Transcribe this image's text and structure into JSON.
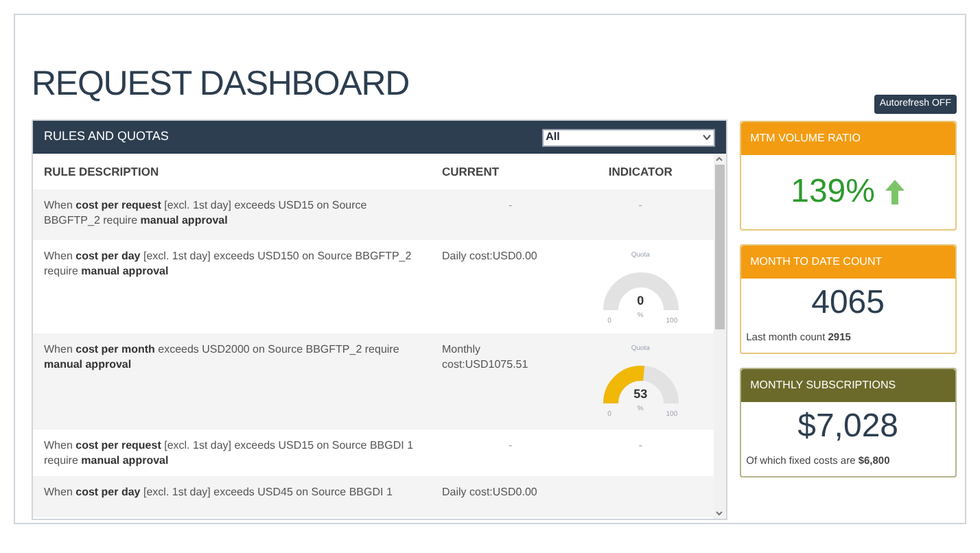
{
  "page_title": "REQUEST DASHBOARD",
  "autorefresh_button": "Autorefresh OFF",
  "rules_panel": {
    "title": "RULES AND QUOTAS",
    "filter": {
      "value": "All"
    },
    "columns": [
      "RULE DESCRIPTION",
      "CURRENT",
      "INDICATOR"
    ],
    "rows": [
      {
        "description": "When **cost per request** [excl. 1st day] exceeds USD15 on Source BBGFTP_2 require **manual approval**",
        "current": "-",
        "indicator": {
          "kind": "none",
          "text": "-"
        }
      },
      {
        "description": "When **cost per day** [excl. 1st day] exceeds USD150 on Source BBGFTP_2 require **manual approval**",
        "current": "Daily cost:USD0.00",
        "indicator": {
          "kind": "gauge",
          "label": "Quota",
          "value": "0",
          "unit": "%",
          "min": "0",
          "max": "100"
        }
      },
      {
        "description": "When **cost per month** exceeds USD2000 on Source BBGFTP_2 require **manual approval**",
        "current": "Monthly cost:USD1075.51",
        "indicator": {
          "kind": "gauge",
          "label": "Quota",
          "value": "53",
          "unit": "%",
          "min": "0",
          "max": "100",
          "level": 0.53
        }
      },
      {
        "description": "When **cost per request** [excl. 1st day] exceeds USD15 on Source BBGDI 1 require **manual approval**",
        "current": "-",
        "indicator": {
          "kind": "none",
          "text": "-"
        }
      },
      {
        "description": "When **cost per day** [excl. 1st day] exceeds USD45 on Source BBGDI 1",
        "current": "Daily cost:USD0.00",
        "indicator": {
          "kind": "cut"
        }
      }
    ]
  },
  "cards": [
    {
      "kind": "rising",
      "title": "MTM VOLUME RATIO",
      "color": "#f39c12",
      "value": "139%"
    },
    {
      "kind": "plain",
      "title": "MONTH TO DATE COUNT",
      "color": "#f39c12",
      "value": "4065",
      "note": "Last month count **2915**"
    },
    {
      "kind": "plain",
      "title": "MONTHLY SUBSCRIPTIONS",
      "color": "#6b6a2a",
      "value": "$7,028",
      "note": "Of which fixed costs are **$6,800**"
    }
  ]
}
